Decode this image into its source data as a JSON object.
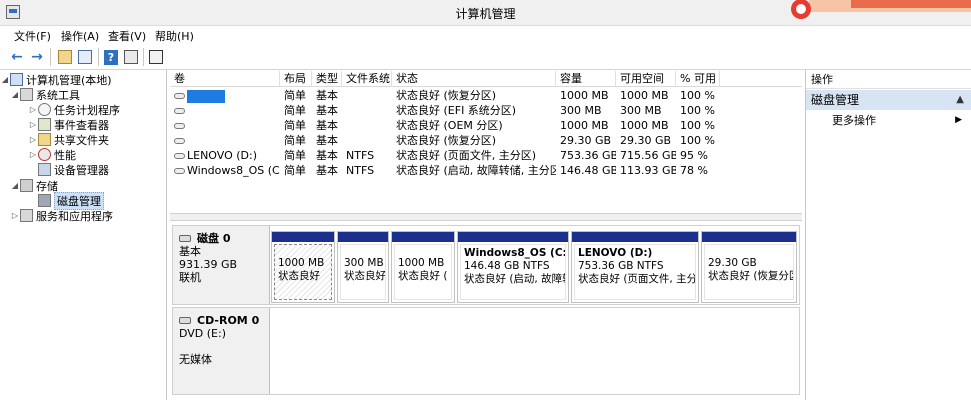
{
  "window": {
    "title": "计算机管理"
  },
  "menu": [
    "文件(F)",
    "操作(A)",
    "查看(V)",
    "帮助(H)"
  ],
  "toolbar": {
    "icons": [
      "back-arrow-icon",
      "forward-arrow-icon",
      "up-folder-icon",
      "show-tree-icon",
      "help-icon",
      "properties-icon"
    ]
  },
  "tree": {
    "items": [
      {
        "label": "计算机管理(本地)",
        "icon": "computer-icon"
      },
      {
        "label": "系统工具",
        "icon": "tools-icon"
      },
      {
        "label": "任务计划程序",
        "icon": "clock-icon"
      },
      {
        "label": "事件查看器",
        "icon": "event-log-icon"
      },
      {
        "label": "共享文件夹",
        "icon": "shared-folder-icon"
      },
      {
        "label": "性能",
        "icon": "performance-icon"
      },
      {
        "label": "设备管理器",
        "icon": "device-manager-icon"
      },
      {
        "label": "存储",
        "icon": "storage-icon"
      },
      {
        "label": "磁盘管理",
        "icon": "disk-icon"
      },
      {
        "label": "服务和应用程序",
        "icon": "services-icon"
      }
    ]
  },
  "volumes": {
    "headers": [
      "卷",
      "布局",
      "类型",
      "文件系统",
      "状态",
      "容量",
      "可用空间",
      "% 可用"
    ],
    "rows": [
      {
        "name": "",
        "layout": "简单",
        "type": "基本",
        "fs": "",
        "status": "状态良好 (恢复分区)",
        "capacity": "1000 MB",
        "free": "1000 MB",
        "pct": "100 %"
      },
      {
        "name": "",
        "layout": "简单",
        "type": "基本",
        "fs": "",
        "status": "状态良好 (EFI 系统分区)",
        "capacity": "300 MB",
        "free": "300 MB",
        "pct": "100 %"
      },
      {
        "name": "",
        "layout": "简单",
        "type": "基本",
        "fs": "",
        "status": "状态良好 (OEM 分区)",
        "capacity": "1000 MB",
        "free": "1000 MB",
        "pct": "100 %"
      },
      {
        "name": "",
        "layout": "简单",
        "type": "基本",
        "fs": "",
        "status": "状态良好 (恢复分区)",
        "capacity": "29.30 GB",
        "free": "29.30 GB",
        "pct": "100 %"
      },
      {
        "name": "LENOVO (D:)",
        "layout": "简单",
        "type": "基本",
        "fs": "NTFS",
        "status": "状态良好 (页面文件, 主分区)",
        "capacity": "753.36 GB",
        "free": "715.56 GB",
        "pct": "95 %"
      },
      {
        "name": "Windows8_OS (C:)",
        "layout": "简单",
        "type": "基本",
        "fs": "NTFS",
        "status": "状态良好 (启动, 故障转储, 主分区)",
        "capacity": "146.48 GB",
        "free": "113.93 GB",
        "pct": "78 %"
      }
    ]
  },
  "disks": [
    {
      "name": "磁盘 0",
      "type": "基本",
      "size": "931.39 GB",
      "state": "联机",
      "partitions": [
        {
          "title": "",
          "size": "1000 MB",
          "status": "状态良好"
        },
        {
          "title": "",
          "size": "300 MB",
          "status": "状态良好"
        },
        {
          "title": "",
          "size": "1000 MB",
          "status": "状态良好 ("
        },
        {
          "title": "Windows8_OS  (C:)",
          "size": "146.48 GB NTFS",
          "status": "状态良好 (启动, 故障转"
        },
        {
          "title": "LENOVO  (D:)",
          "size": "753.36 GB NTFS",
          "status": "状态良好 (页面文件, 主分"
        },
        {
          "title": "",
          "size": "29.30 GB",
          "status": "状态良好 (恢复分区)"
        }
      ]
    },
    {
      "name": "CD-ROM 0",
      "type": "DVD (E:)",
      "size": "",
      "state": "无媒体",
      "partitions": []
    }
  ],
  "actions": {
    "title": "操作",
    "section": "磁盘管理",
    "items": [
      "更多操作"
    ]
  },
  "colors": {
    "partition_bar": "#1c2f8c",
    "selection": "#cce0f7",
    "action_section": "#d6e4f4",
    "redacted_name": "#1e7be2"
  }
}
